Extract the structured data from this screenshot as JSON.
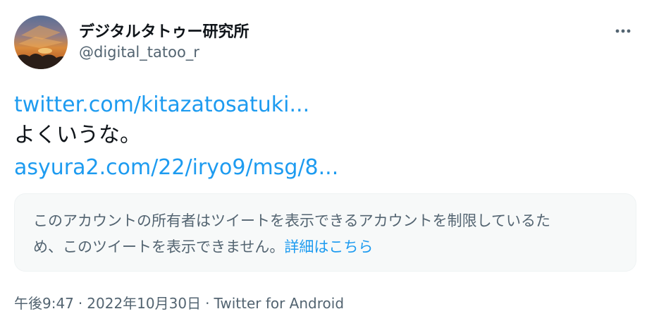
{
  "user": {
    "display_name": "デジタルタトゥー研究所",
    "handle": "@digital_tatoo_r",
    "avatar_icon": "avatar-sunset-photo"
  },
  "header": {
    "more_icon": "more-options-icon"
  },
  "body": {
    "link1": "twitter.com/kitazatosatuki...",
    "text": "よくいうな。",
    "link2": "asyura2.com/22/iryo9/msg/8..."
  },
  "notice": {
    "line1": "このアカウントの所有者はツイートを表示できるアカウントを制限しているた",
    "line2_prefix": "め、このツイートを表示できません。",
    "learn_more": "詳細はこちら"
  },
  "meta": {
    "time": "午後9:47",
    "separator": "·",
    "date": "2022年10月30日",
    "source": "Twitter for Android"
  },
  "colors": {
    "link": "#1d9bf0",
    "text": "#0f1419",
    "secondary": "#536471",
    "notice_bg": "#f7f9f9"
  }
}
